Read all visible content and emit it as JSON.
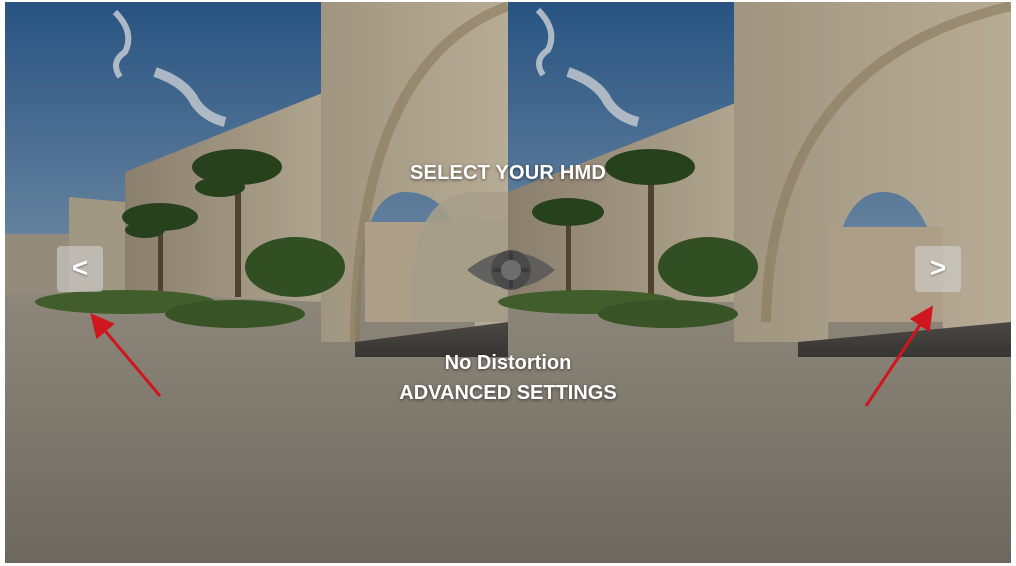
{
  "hmd_selector": {
    "title": "SELECT YOUR HMD",
    "prev_label": "<",
    "next_label": ">",
    "current_mode": "No Distortion",
    "advanced_settings_label": "ADVANCED SETTINGS",
    "center_icon": "eye-icon"
  },
  "annotations": {
    "arrow_color": "#d0161e",
    "arrow_targets": [
      "previous-hmd-button",
      "next-hmd-button"
    ]
  },
  "colors": {
    "text": "#ffffff",
    "button_bg": "rgba(215,215,215,0.55)",
    "eye_icon": "#5a5a5a"
  }
}
